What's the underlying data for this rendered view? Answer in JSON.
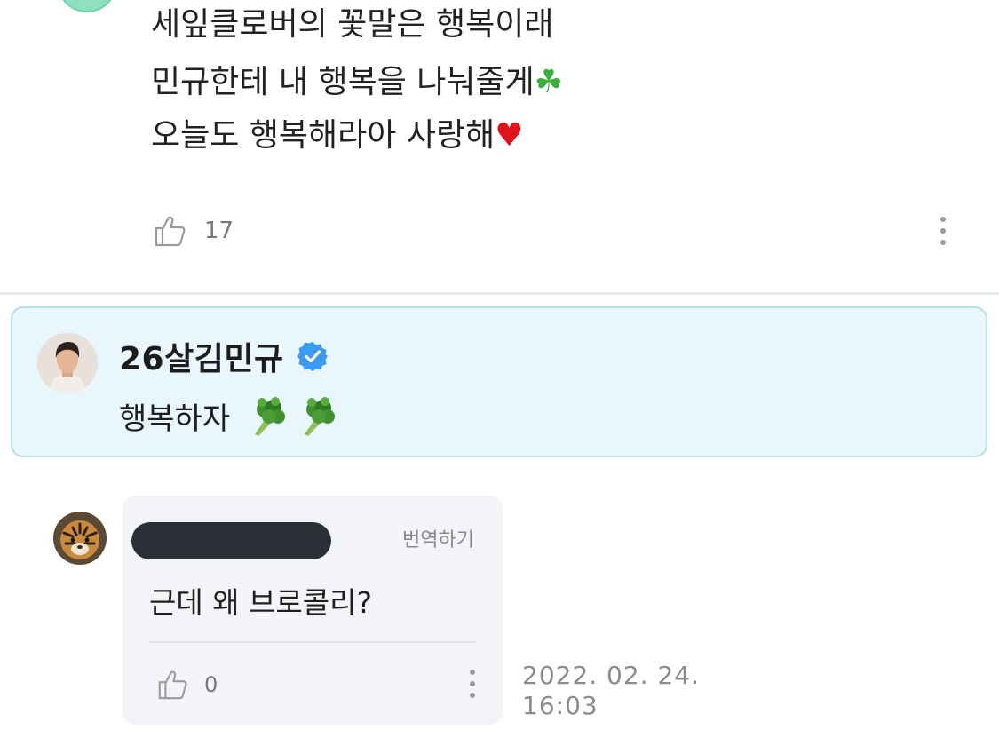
{
  "post": {
    "lines": [
      "세잎클로버의 꽃말은 행복이래",
      "민규한테 내 행복을 나눠줄게",
      "오늘도 행복해라아 사랑해"
    ],
    "clover_emoji": "☘",
    "heart_emoji": "♥",
    "like_count": "17"
  },
  "artist_reply": {
    "name": "26살김민규",
    "text": "행복하자"
  },
  "fan_comment": {
    "translate_label": "번역하기",
    "text": "근데 왜 브로콜리?",
    "like_count": "0",
    "timestamp_date": "2022. 02. 24.",
    "timestamp_time": "16:03"
  },
  "colors": {
    "artist_card_bg": "#e9f6fd",
    "artist_card_border": "#b8dfe8",
    "verified_badge": "#3b9bf1",
    "fan_card_bg": "#f3f4f7"
  }
}
